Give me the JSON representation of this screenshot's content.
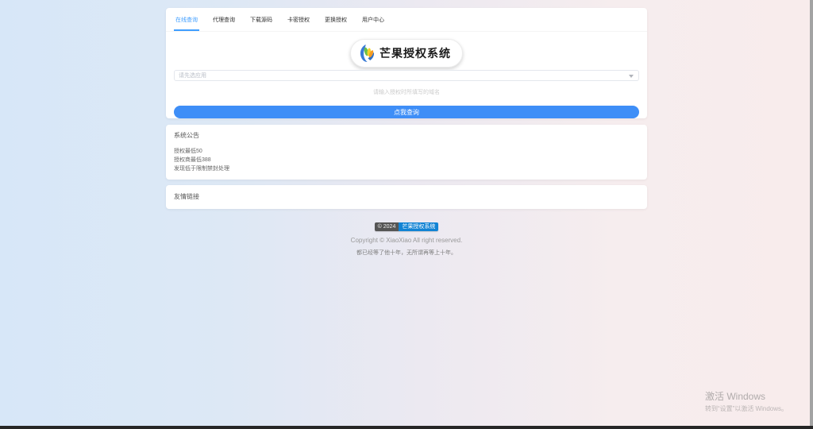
{
  "tabs": [
    {
      "label": "在线查询",
      "active": true
    },
    {
      "label": "代理查询",
      "active": false
    },
    {
      "label": "下载源码",
      "active": false
    },
    {
      "label": "卡密授权",
      "active": false
    },
    {
      "label": "更换授权",
      "active": false
    },
    {
      "label": "用户中心",
      "active": false
    }
  ],
  "logo": {
    "title": "芒果授权系统"
  },
  "query": {
    "select_placeholder": "请先选应用",
    "hint": "请输入授权时所填写的域名",
    "button_label": "点我查询"
  },
  "announcement": {
    "title": "系统公告",
    "lines": [
      "授权最低50",
      "授权商最低388",
      "发现低于限制禁封处理"
    ]
  },
  "links": {
    "title": "友情链接"
  },
  "footer": {
    "badge_left": "© 2024",
    "badge_right": "芒果授权系统",
    "copyright": "Copyright © XiaoXiao All right reserved.",
    "quote": "都已经等了他十年，无所谓再等上十年。"
  },
  "watermark": {
    "line1": "激活 Windows",
    "line2": "转到“设置”以激活 Windows。"
  },
  "icons": {
    "logo": "mango-logo-icon",
    "select_caret": "chevron-down-icon"
  },
  "colors": {
    "accent": "#409eff",
    "button_blue": "#3e8ef7",
    "badge_blue": "#1283d4",
    "bg_left": "#d7e7f8",
    "bg_right": "#f8ecec"
  }
}
